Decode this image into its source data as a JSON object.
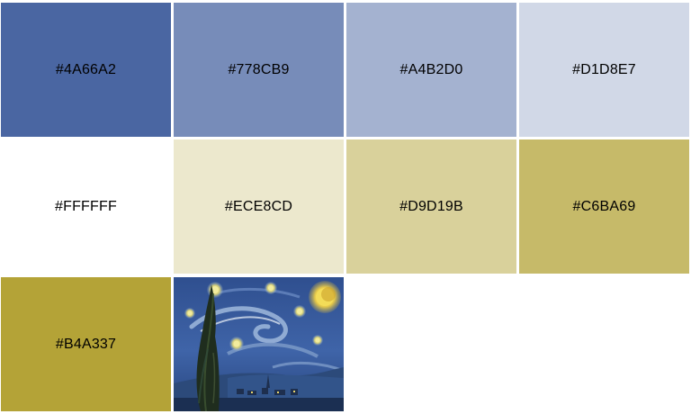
{
  "swatches": [
    {
      "label": "#4A66A2",
      "color": "#4A66A2"
    },
    {
      "label": "#778CB9",
      "color": "#778CB9"
    },
    {
      "label": "#A4B2D0",
      "color": "#A4B2D0"
    },
    {
      "label": "#D1D8E7",
      "color": "#D1D8E7"
    },
    {
      "label": "#FFFFFF",
      "color": "#FFFFFF"
    },
    {
      "label": "#ECE8CD",
      "color": "#ECE8CD"
    },
    {
      "label": "#D9D19B",
      "color": "#D9D19B"
    },
    {
      "label": "#C6BA69",
      "color": "#C6BA69"
    },
    {
      "label": "#B4A337",
      "color": "#B4A337"
    }
  ],
  "image": {
    "name": "starry-night-thumbnail"
  }
}
